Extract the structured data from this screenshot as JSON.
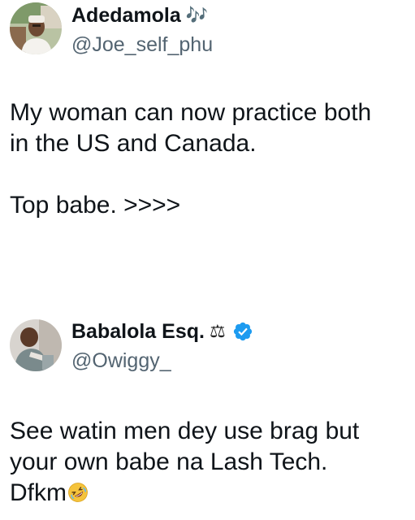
{
  "tweets": [
    {
      "display_name": "Adedamola",
      "name_emoji": "🎶",
      "handle": "@Joe_self_phu",
      "verified": false,
      "lines": [
        "My woman can now practice both",
        "in the US and Canada."
      ],
      "lines2": [
        "Top babe. >>>>"
      ]
    },
    {
      "display_name": "Babalola Esq.",
      "name_emoji": "⚖",
      "handle": "@Owiggy_",
      "verified": true,
      "lines": [
        "See watin men dey use brag but",
        "your own babe na Lash Tech."
      ],
      "last_line": "Dfkm",
      "last_emoji": "rolling-on-floor-laughing-emoji"
    }
  ],
  "colors": {
    "text": "#0f1419",
    "handle": "#536471",
    "verified": "#1d9bf0"
  }
}
